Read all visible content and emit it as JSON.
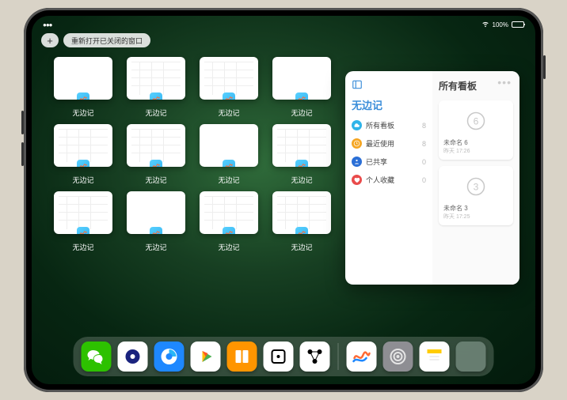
{
  "status": {
    "time": "",
    "battery_pct": "100%"
  },
  "toolbar": {
    "add_label": "+",
    "reopen_label": "重新打开已关闭的窗口"
  },
  "app_name": "无边记",
  "tiles": [
    {
      "label": "无边记",
      "variant": "blank"
    },
    {
      "label": "无边记",
      "variant": "cal"
    },
    {
      "label": "无边记",
      "variant": "cal"
    },
    {
      "label": "无边记",
      "variant": "blank"
    },
    {
      "label": "无边记",
      "variant": "cal"
    },
    {
      "label": "无边记",
      "variant": "cal"
    },
    {
      "label": "无边记",
      "variant": "blank"
    },
    {
      "label": "无边记",
      "variant": "cal"
    },
    {
      "label": "无边记",
      "variant": "cal"
    },
    {
      "label": "无边记",
      "variant": "blank"
    },
    {
      "label": "无边记",
      "variant": "cal"
    },
    {
      "label": "无边记",
      "variant": "cal"
    }
  ],
  "popover": {
    "left_title": "无边记",
    "right_title": "所有看板",
    "categories": [
      {
        "icon": "cloud",
        "color": "#2fb4e9",
        "label": "所有看板",
        "count": 8
      },
      {
        "icon": "clock",
        "color": "#f5a623",
        "label": "最近使用",
        "count": 8
      },
      {
        "icon": "person",
        "color": "#2b6fd6",
        "label": "已共享",
        "count": 0
      },
      {
        "icon": "heart",
        "color": "#e94b4b",
        "label": "个人收藏",
        "count": 0
      }
    ],
    "boards": [
      {
        "title": "未命名 6",
        "subtitle": "昨天 17:26",
        "glyph": "6"
      },
      {
        "title": "未命名 3",
        "subtitle": "昨天 17:25",
        "glyph": "3"
      }
    ]
  },
  "dock": {
    "apps": [
      {
        "name": "wechat",
        "bg": "#2dc100"
      },
      {
        "name": "quark",
        "bg": "#ffffff"
      },
      {
        "name": "qqbrowser",
        "bg": "#1e88ff"
      },
      {
        "name": "video",
        "bg": "#ffffff"
      },
      {
        "name": "books",
        "bg": "#ff9500"
      },
      {
        "name": "dice",
        "bg": "#ffffff"
      },
      {
        "name": "graph",
        "bg": "#ffffff"
      }
    ],
    "recent": [
      {
        "name": "freeform",
        "bg": "#ffffff"
      },
      {
        "name": "settings",
        "bg": "#8e8e93"
      },
      {
        "name": "notes",
        "bg": "#ffffff"
      }
    ],
    "folder_colors": [
      "#3ac558",
      "#ff3b30",
      "#ffcc00",
      "#19a9ff"
    ]
  }
}
